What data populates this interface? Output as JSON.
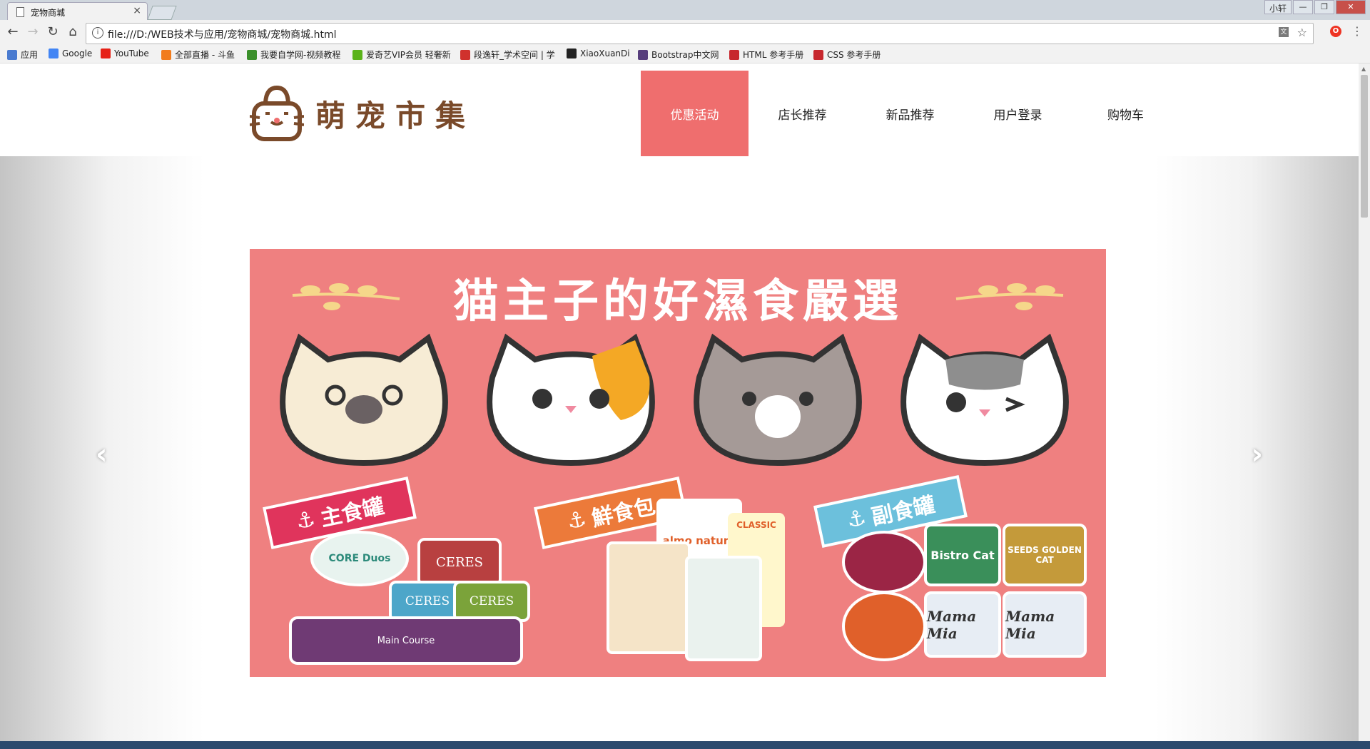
{
  "browser": {
    "tab_title": "宠物商城",
    "tab_close": "×",
    "url": "file:///D:/WEB技术与应用/宠物商城/宠物商城.html",
    "window_user": "小轩",
    "window_min": "—",
    "window_max": "❐",
    "window_close": "✕",
    "nav_back": "←",
    "nav_forward": "→",
    "nav_reload": "↻",
    "nav_home": "⌂",
    "star": "☆",
    "menu": "⋮",
    "bookmarks": [
      {
        "label": "应用",
        "icon": "apps-icon",
        "color": "#4a7bd0"
      },
      {
        "label": "Google",
        "icon": "google-icon",
        "color": "#4285f4"
      },
      {
        "label": "YouTube",
        "icon": "youtube-icon",
        "color": "#e62117"
      },
      {
        "label": "全部直播 - 斗鱼",
        "icon": "douyu-icon",
        "color": "#f27c1c"
      },
      {
        "label": "我要自学网-视频教程",
        "icon": "zixue-icon",
        "color": "#3a8f2a"
      },
      {
        "label": "爱奇艺VIP会员 轻奢新",
        "icon": "iqiyi-icon",
        "color": "#5bb31a"
      },
      {
        "label": "段逸轩_学术空间 | 学",
        "icon": "blog-icon",
        "color": "#d0312d"
      },
      {
        "label": "XiaoXuanDi",
        "icon": "github-icon",
        "color": "#222222"
      },
      {
        "label": "Bootstrap中文网",
        "icon": "bootstrap-icon",
        "color": "#563d7c"
      },
      {
        "label": "HTML 参考手册",
        "icon": "w3school-icon",
        "color": "#c7282e"
      },
      {
        "label": "CSS 参考手册",
        "icon": "w3school-icon",
        "color": "#c7282e"
      }
    ]
  },
  "site": {
    "logo_text": "萌宠市集",
    "nav": [
      {
        "label": "优惠活动",
        "active": true
      },
      {
        "label": "店长推荐",
        "active": false
      },
      {
        "label": "新品推荐",
        "active": false
      },
      {
        "label": "用户登录",
        "active": false
      },
      {
        "label": "购物车",
        "active": false
      }
    ]
  },
  "carousel": {
    "prev": "‹",
    "next": "›",
    "banner_title": "猫主子的好濕食嚴選",
    "labels": [
      "主食罐",
      "鮮食包",
      "副食罐"
    ],
    "products": [
      "CORE Duos",
      "CERES",
      "CERES",
      "CERES",
      "Main Course",
      "almo nature",
      "CLASSIC",
      "Bistro Cat",
      "SEEDS GOLDEN CAT",
      "Mama Mia",
      "Mama Mia"
    ],
    "colors": {
      "banner_bg": "#ef8080",
      "label1": "#e0345c",
      "label2": "#ec7a3a",
      "label3": "#6cc0dc"
    }
  }
}
